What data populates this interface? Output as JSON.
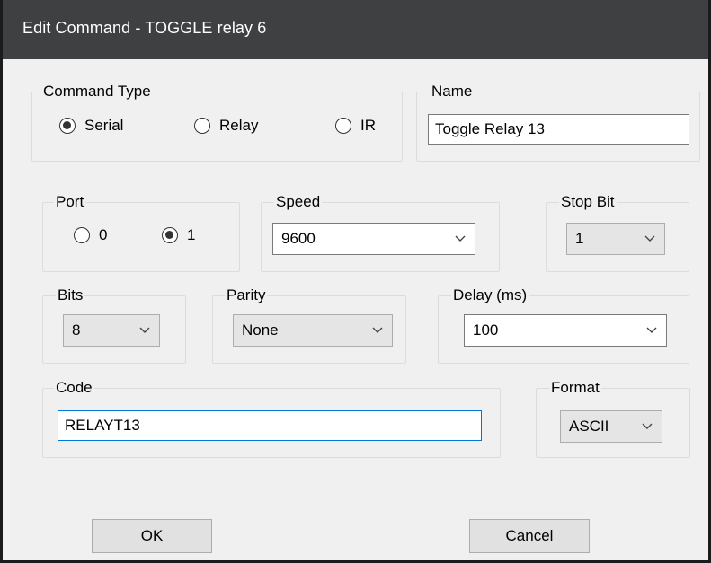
{
  "window": {
    "title": "Edit Command - TOGGLE relay 6"
  },
  "command_type": {
    "legend": "Command Type",
    "options": [
      {
        "label": "Serial",
        "checked": true
      },
      {
        "label": "Relay",
        "checked": false
      },
      {
        "label": "IR",
        "checked": false
      }
    ]
  },
  "name": {
    "legend": "Name",
    "value": "Toggle Relay 13"
  },
  "port": {
    "legend": "Port",
    "options": [
      {
        "label": "0",
        "checked": false
      },
      {
        "label": "1",
        "checked": true
      }
    ]
  },
  "speed": {
    "legend": "Speed",
    "selected": "9600"
  },
  "stop_bit": {
    "legend": "Stop Bit",
    "selected": "1"
  },
  "bits": {
    "legend": "Bits",
    "selected": "8"
  },
  "parity": {
    "legend": "Parity",
    "selected": "None"
  },
  "delay": {
    "legend": "Delay (ms)",
    "selected": "100"
  },
  "code": {
    "legend": "Code",
    "value": "RELAYT13"
  },
  "format": {
    "legend": "Format",
    "selected": "ASCII"
  },
  "buttons": {
    "ok": "OK",
    "cancel": "Cancel"
  },
  "colors": {
    "titlebar": "#3f4042",
    "dialog_bg": "#f0f0f0",
    "focus_border": "#0078d7"
  }
}
